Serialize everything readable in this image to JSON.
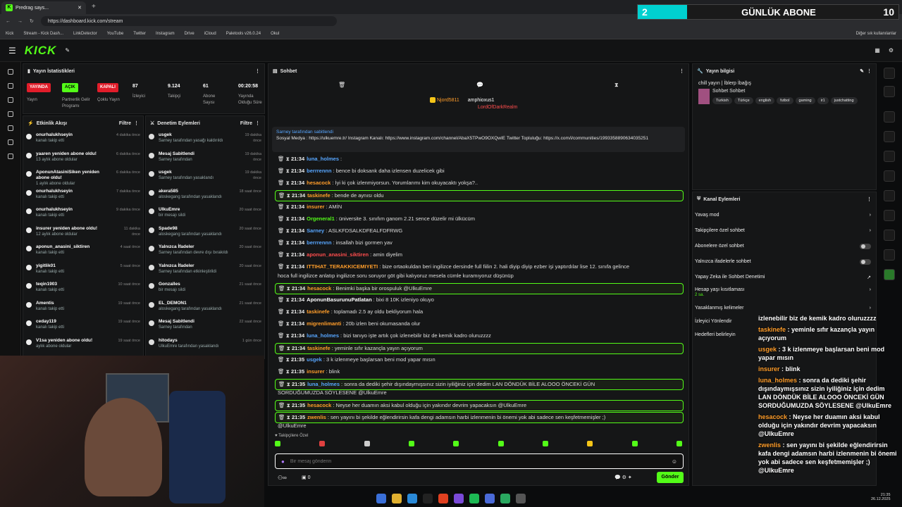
{
  "browser": {
    "tab_title": "Predrag says...",
    "url": "https://dashboard.kick.com/stream",
    "bookmarks": [
      "Kick",
      "Stream - Kick Dash...",
      "LinkDetector",
      "YouTube",
      "Twitter",
      "Instagram",
      "Drive",
      "iCloud",
      "Paletools v26.0.24",
      "Okul"
    ],
    "other_bookmarks": "Diğer sık kullanılanlar"
  },
  "overlay": {
    "num": "2",
    "title": "GÜNLÜK ABONE",
    "count": "10"
  },
  "logo": "KICK",
  "stats": {
    "title": "Yayın İstatistikleri",
    "live": "YAYINDA",
    "live_label": "Yayın",
    "on": "AÇIK",
    "on_label": "Partnerlik Gelir Programı",
    "off": "KAPALI",
    "off_label": "Çoklu Yayın",
    "viewers": "87",
    "viewers_label": "İzleyici",
    "followers": "9.124",
    "followers_label": "Takipçi",
    "subs": "61",
    "subs_label": "Abone Sayısı",
    "duration": "00:20:58",
    "duration_label": "Yayında Olduğu Süre"
  },
  "activity": {
    "title": "Etkinlik Akışı",
    "filter": "Filtre",
    "items": [
      {
        "name": "onurhalukhseyin",
        "sub": "kanalı takip etti",
        "time": "4 dakika önce"
      },
      {
        "name": "yaaren yeniden abone oldu!",
        "sub": "13 aylık abone oldular",
        "time": "6 dakika önce"
      },
      {
        "name": "AponunAtasiniSiken yeniden abone oldu!",
        "sub": "1 aylık abone oldular",
        "time": "6 dakika önce"
      },
      {
        "name": "onurhalukhseyin",
        "sub": "kanalı takip etti",
        "time": "7 dakika önce"
      },
      {
        "name": "onurhalukhseyin",
        "sub": "kanalı takip etti",
        "time": "9 dakika önce"
      },
      {
        "name": "insurer yeniden abone oldu!",
        "sub": "12 aylık abone oldular",
        "time": "11 dakika önce"
      },
      {
        "name": "aponun_anasini_siktiren",
        "sub": "kanalı takip etti",
        "time": "4 saat önce"
      },
      {
        "name": "yigitlik01",
        "sub": "kanalı takip etti",
        "time": "5 saat önce"
      },
      {
        "name": "teqin1903",
        "sub": "kanalı takip etti",
        "time": "10 saat önce"
      },
      {
        "name": "Amentis",
        "sub": "kanalı takip etti",
        "time": "19 saat önce"
      },
      {
        "name": "ceday119",
        "sub": "kanalı takip etti",
        "time": "19 saat önce"
      },
      {
        "name": "V1sa yeniden abone oldu!",
        "sub": "aylık abone oldular",
        "time": "19 saat önce"
      }
    ]
  },
  "moderation": {
    "title": "Denetim Eylemleri",
    "filter": "Filtre",
    "items": [
      {
        "name": "usgek",
        "sub": "Sarney tarafından yasağı kaldırıldı",
        "time": "19 dakika önce"
      },
      {
        "name": "Mesaj Sabitlendi",
        "sub": "Sarney tarafından",
        "time": "19 dakika önce"
      },
      {
        "name": "usgek",
        "sub": "Sarney tarafından yasaklandı",
        "time": "19 dakika önce"
      },
      {
        "name": "akera585",
        "sub": "aloskegang tarafından yasaklandı",
        "time": "18 saat önce"
      },
      {
        "name": "UlkuEmre",
        "sub": "bir mesajı sildi",
        "time": "20 saat önce"
      },
      {
        "name": "Spade98",
        "sub": "aloskegang tarafından yasaklandı",
        "time": "20 saat önce"
      },
      {
        "name": "Yalnızca İfadeler",
        "sub": "Sarney tarafından devre dışı bırakıldı",
        "time": "20 saat önce"
      },
      {
        "name": "Yalnızca İfadeler",
        "sub": "Sarney tarafından etkinleştirildi",
        "time": "20 saat önce"
      },
      {
        "name": "Gonzalles",
        "sub": "bir mesajı sildi",
        "time": "21 saat önce"
      },
      {
        "name": "EL_DEMON1",
        "sub": "aloskegang tarafından yasaklandı",
        "time": "21 saat önce"
      },
      {
        "name": "Mesaj Sabitlendi",
        "sub": "Sarney tarafından",
        "time": "22 saat önce"
      },
      {
        "name": "hitodays",
        "sub": "UlkuEmre tarafından yasaklandı",
        "time": "1 gün önce"
      }
    ]
  },
  "chat": {
    "title": "Sohbet",
    "top1": "Njord5811",
    "top2": "amphioxus1",
    "top3": "LordOfDarkRealm",
    "pinned_by": "Sarney tarafından sabitlendi",
    "pinned_text": "Sosyal Medya : https://ulkuemre.tr/ Instagram Kanalı: https://www.instagram.com/channel/AbaX5TPwO9OXQwIE Twitter Topluluğu: https://x.com/i/communities/1993358890634035251",
    "messages": [
      {
        "t": "21:34",
        "u": "luna_holmes",
        "c": "blu",
        "m": ""
      },
      {
        "t": "21:34",
        "u": "berrrennn",
        "c": "blu",
        "m": "bence bi doksank daha izlensen duzelicek gibi"
      },
      {
        "t": "21:34",
        "u": "hesacock",
        "c": "orng",
        "m": "İyi ki çok izlenmiyorsun. Yorumlarımı kim okuyacaktı yokşa?.."
      },
      {
        "t": "21:34",
        "u": "taskinefe",
        "c": "orng",
        "m": "bende de aynısı oldu"
      },
      {
        "t": "21:34",
        "u": "insurer",
        "c": "orng",
        "m": "AMİN"
      },
      {
        "t": "21:34",
        "u": "Orgeneral1",
        "c": "grn",
        "m": "üniversite 3. sınıfım ganom 2.21 sence düzelir mi ülkücüm"
      },
      {
        "t": "21:34",
        "u": "Sarney",
        "c": "blu",
        "m": "ASLKFDSALKDFEALFDFRWG"
      },
      {
        "t": "21:34",
        "u": "berrrennn",
        "c": "blu",
        "m": "insallah bizi gormen yav"
      },
      {
        "t": "21:34",
        "u": "aponun_anasini_siktiren",
        "c": "red",
        "m": "amin diyelim"
      },
      {
        "t": "21:34",
        "u": "ITTIHAT_TERAKKICEMIYETI",
        "c": "orng",
        "m": "bize ortaokuldan beri ingilizce dersinde full fiilin 2. hali diyip diyip ezber işi yaptırdılar lise 12. sınıfa gelince"
      },
      {
        "t": "",
        "u": "",
        "c": "wht",
        "m": "hoca full ingilizce anlatıp ingilizce soru soruyor göt gibi kalıyoruz mesela cümle kuramıyoruz düşünüp"
      },
      {
        "t": "21:34",
        "u": "hesacock",
        "c": "orng",
        "m": "Benimki başka bir orospuluk @UlkuEmre"
      },
      {
        "t": "21:34",
        "u": "AponunBasurunuPatlatan",
        "c": "wht",
        "m": "bixi 8 10K izleniyo okuyo"
      },
      {
        "t": "21:34",
        "u": "taskinefe",
        "c": "orng",
        "m": "toplamadı 2.5 ay oldu bekliyorum hala"
      },
      {
        "t": "21:34",
        "u": "migrenlimanti",
        "c": "orng",
        "m": "20b izlen beni okumasanda olur"
      },
      {
        "t": "21:34",
        "u": "luna_holmes",
        "c": "blu",
        "m": "bizi tanıyo işte artık çok izlenebilir biz de kemik kadro oluruzzzz"
      },
      {
        "t": "21:34",
        "u": "taskinefe",
        "c": "orng",
        "m": "yeminle sıfır kazançla yayın açıyorum"
      },
      {
        "t": "21:35",
        "u": "usgek",
        "c": "blu",
        "m": "3 k izlenmeye başlarsan beni mod yapar mısın"
      },
      {
        "t": "21:35",
        "u": "insurer",
        "c": "orng",
        "m": "blink"
      },
      {
        "t": "21:35",
        "u": "luna_holmes",
        "c": "blu",
        "m": "sonra da dediki şehir dışındaymışsınız sizin iyiliğiniz için dedim LAN DÖNDÜK BİLE ALOOO ÖNCEKİ GÜN"
      },
      {
        "t": "",
        "u": "",
        "c": "wht",
        "m": "SORDUĞUMUZDA SÖYLESENE @UlkuEmre"
      },
      {
        "t": "21:35",
        "u": "hesacock",
        "c": "orng",
        "m": "Neyse her duamın aksi kabul olduğu için yakındır devrim yapacaksın @UlkuEmre"
      },
      {
        "t": "21:35",
        "u": "zwenlis",
        "c": "orng",
        "m": "sen yayını bi şekilde eğlendirirsin kafa dengi adamsın harbi izlenmenin bi önemi yok abi sadece sen keşfetmemişler ;)"
      },
      {
        "t": "",
        "u": "",
        "c": "wht",
        "m": "@UlkuEmre"
      }
    ],
    "followers_only": "Takipçilere Özel",
    "placeholder": "Bir mesaj gönderin",
    "send": "Gönder",
    "count": "0"
  },
  "info": {
    "title": "Yayın bilgisi",
    "stream_title": "chill yayın | İblerp İbağış",
    "category": "Sohbet Sohbet",
    "tags": [
      "Turkish",
      "Türkçe",
      "english",
      "futbol",
      "gaming",
      "ir1",
      "justchatting"
    ]
  },
  "channel": {
    "title": "Kanal Eylemleri",
    "items": [
      "Yavaş mod",
      "Takipçilere özel sohbet",
      "Abonelere özel sohbet",
      "Yalnızca ifadelerle sohbet",
      "Yapay Zeka ile Sohbet Denetimi",
      "Hesap yaşı kısıtlaması",
      "Yasaklanmış kelimeler",
      "İzleyici Yönlendir",
      "Hedefleri belirleyin"
    ],
    "age_value": "2 sa."
  },
  "overlay_chat": [
    {
      "u": "",
      "m": "izlenebilir biz de kemik kadro oluruzzzz"
    },
    {
      "u": "taskinefe",
      "m": "yeminle sıfır kazançla yayın açıyorum"
    },
    {
      "u": "usgek",
      "m": "3 k izlenmeye başlarsan beni mod yapar mısın"
    },
    {
      "u": "insurer",
      "m": "blink"
    },
    {
      "u": "luna_holmes",
      "m": "sonra da dediki şehir dışındaymışsınız sizin iyiliğiniz için dedim LAN DÖNDÜK BİLE ALOOO ÖNCEKİ GÜN SORDUĞUMUZDA SÖYLESENE @UlkuEmre"
    },
    {
      "u": "hesacock",
      "m": "Neyse her duamın aksi kabul olduğu için yakındır devrim yapacaksın @UlkuEmre"
    },
    {
      "u": "zwenlis",
      "m": "sen yayını bi şekilde eğlendirirsin kafa dengi adamsın harbi izlenmenin bi önemi yok abi sadece sen keşfetmemişler ;) @UlkuEmre"
    }
  ],
  "clock": {
    "time": "21:35",
    "date": "26.12.2025"
  }
}
